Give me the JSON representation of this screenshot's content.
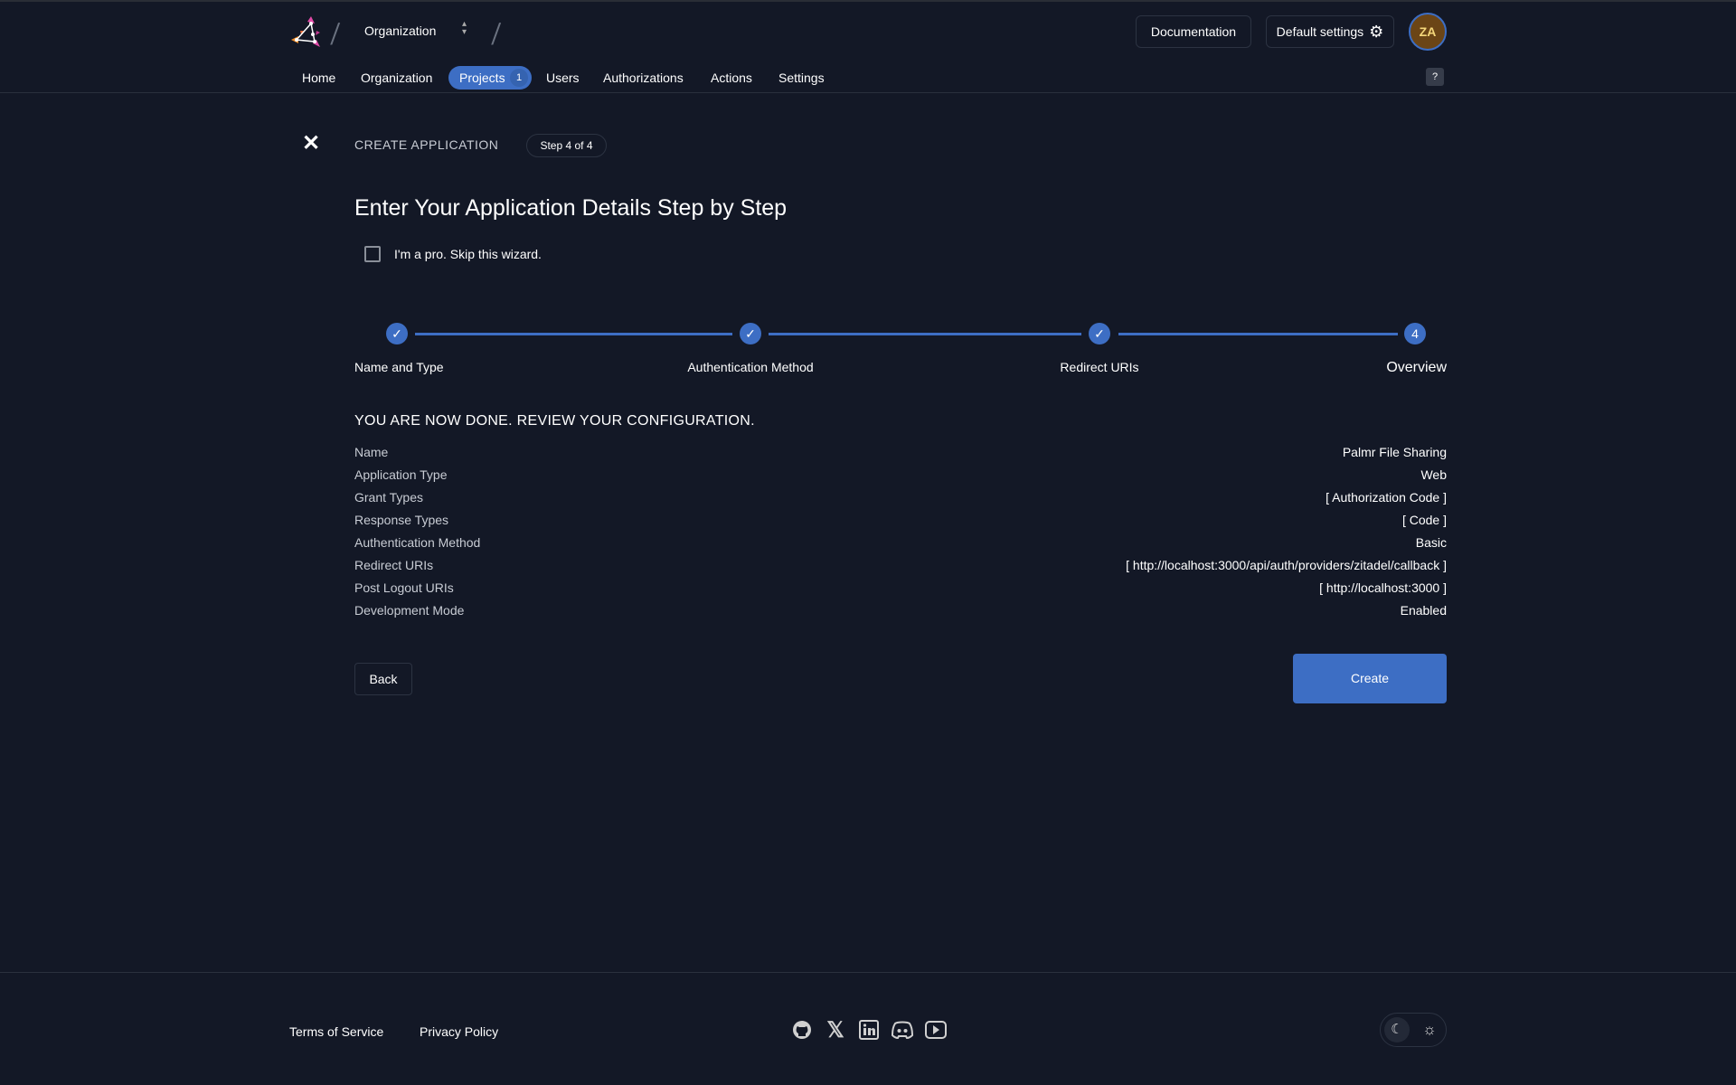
{
  "header": {
    "org_switcher": "Organization",
    "documentation": "Documentation",
    "default_settings": "Default settings",
    "avatar_initials": "ZA",
    "help": "?"
  },
  "nav": [
    {
      "label": "Home"
    },
    {
      "label": "Organization"
    },
    {
      "label": "Projects",
      "badge": "1",
      "active": true
    },
    {
      "label": "Users"
    },
    {
      "label": "Authorizations"
    },
    {
      "label": "Actions"
    },
    {
      "label": "Settings"
    }
  ],
  "wizard": {
    "heading": "CREATE APPLICATION",
    "step_badge": "Step 4 of 4",
    "title": "Enter Your Application Details Step by Step",
    "skip_label": "I'm a pro. Skip this wizard.",
    "skip_checked": false,
    "steps": [
      {
        "label": "Name and Type",
        "done": true
      },
      {
        "label": "Authentication Method",
        "done": true
      },
      {
        "label": "Redirect URIs",
        "done": true
      },
      {
        "label": "Overview",
        "number": "4",
        "current": true
      }
    ],
    "review_heading": "YOU ARE NOW DONE. REVIEW YOUR CONFIGURATION.",
    "review": [
      {
        "key": "Name",
        "value": "Palmr File Sharing"
      },
      {
        "key": "Application Type",
        "value": "Web"
      },
      {
        "key": "Grant Types",
        "value": "[ Authorization Code ]"
      },
      {
        "key": "Response Types",
        "value": "[ Code ]"
      },
      {
        "key": "Authentication Method",
        "value": "Basic"
      },
      {
        "key": "Redirect URIs",
        "value": "[ http://localhost:3000/api/auth/providers/zitadel/callback ]"
      },
      {
        "key": "Post Logout URIs",
        "value": "[ http://localhost:3000 ]"
      },
      {
        "key": "Development Mode",
        "value": "Enabled"
      }
    ],
    "back": "Back",
    "create": "Create"
  },
  "footer": {
    "terms": "Terms of Service",
    "privacy": "Privacy Policy",
    "social": [
      "github-icon",
      "x-icon",
      "linkedin-icon",
      "discord-icon",
      "youtube-icon"
    ]
  },
  "colors": {
    "accent": "#3d6ec4",
    "background": "#131826",
    "avatar": "#6b4516"
  }
}
